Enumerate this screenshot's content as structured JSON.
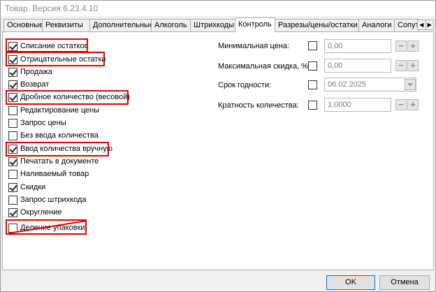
{
  "window": {
    "title": "Товар. Версия 6.23.4.10"
  },
  "tabs": [
    "Основные",
    "Реквизиты",
    "Дополнительные",
    "Алкоголь",
    "Штрихкоды",
    "Контроль",
    "Разрезы/цены/остатки",
    "Аналоги",
    "Сопут"
  ],
  "active_tab": "Контроль",
  "tab_scroll": {
    "left": "◀",
    "right": "▶"
  },
  "checkboxes": [
    {
      "label": "Списание остатков",
      "checked": true,
      "highlighted": true
    },
    {
      "label": "Отрицательные остатки",
      "checked": true,
      "highlighted": true
    },
    {
      "label": "Продажа",
      "checked": true,
      "highlighted": false
    },
    {
      "label": "Возврат",
      "checked": true,
      "highlighted": false
    },
    {
      "label": "Дробное количество (весовой)",
      "checked": true,
      "highlighted": true
    },
    {
      "label": "Редактирование цены",
      "checked": false,
      "highlighted": false
    },
    {
      "label": "Запрос цены",
      "checked": false,
      "highlighted": false
    },
    {
      "label": "Без ввода количества",
      "checked": false,
      "highlighted": false
    },
    {
      "label": "Ввод количества вручную",
      "checked": true,
      "highlighted": true
    },
    {
      "label": "Печатать в документе",
      "checked": true,
      "highlighted": false
    },
    {
      "label": "Наливаемый товар",
      "checked": false,
      "highlighted": false
    },
    {
      "label": "Скидки",
      "checked": true,
      "highlighted": false
    },
    {
      "label": "Запрос штрихкода",
      "checked": false,
      "highlighted": false
    },
    {
      "label": "Округление",
      "checked": true,
      "highlighted": false
    },
    {
      "label": "Деление упаковки",
      "checked": false,
      "highlighted": true,
      "struck": true
    }
  ],
  "fields": {
    "min_price": {
      "label": "Минимальная цена:",
      "checked": false,
      "value": "0,00"
    },
    "max_discount": {
      "label": "Максимальная скидка, %:",
      "checked": false,
      "value": "0,00"
    },
    "expiry": {
      "label": "Срок годности:",
      "checked": false,
      "value": "06.02.2025"
    },
    "multiplicity": {
      "label": "Кратность количества:",
      "checked": false,
      "value": "1,0000"
    }
  },
  "spin_glyphs": {
    "minus": "−",
    "plus": "+"
  },
  "buttons": {
    "ok": "OK",
    "cancel": "Отмена"
  },
  "highlight_color": "#e00000"
}
